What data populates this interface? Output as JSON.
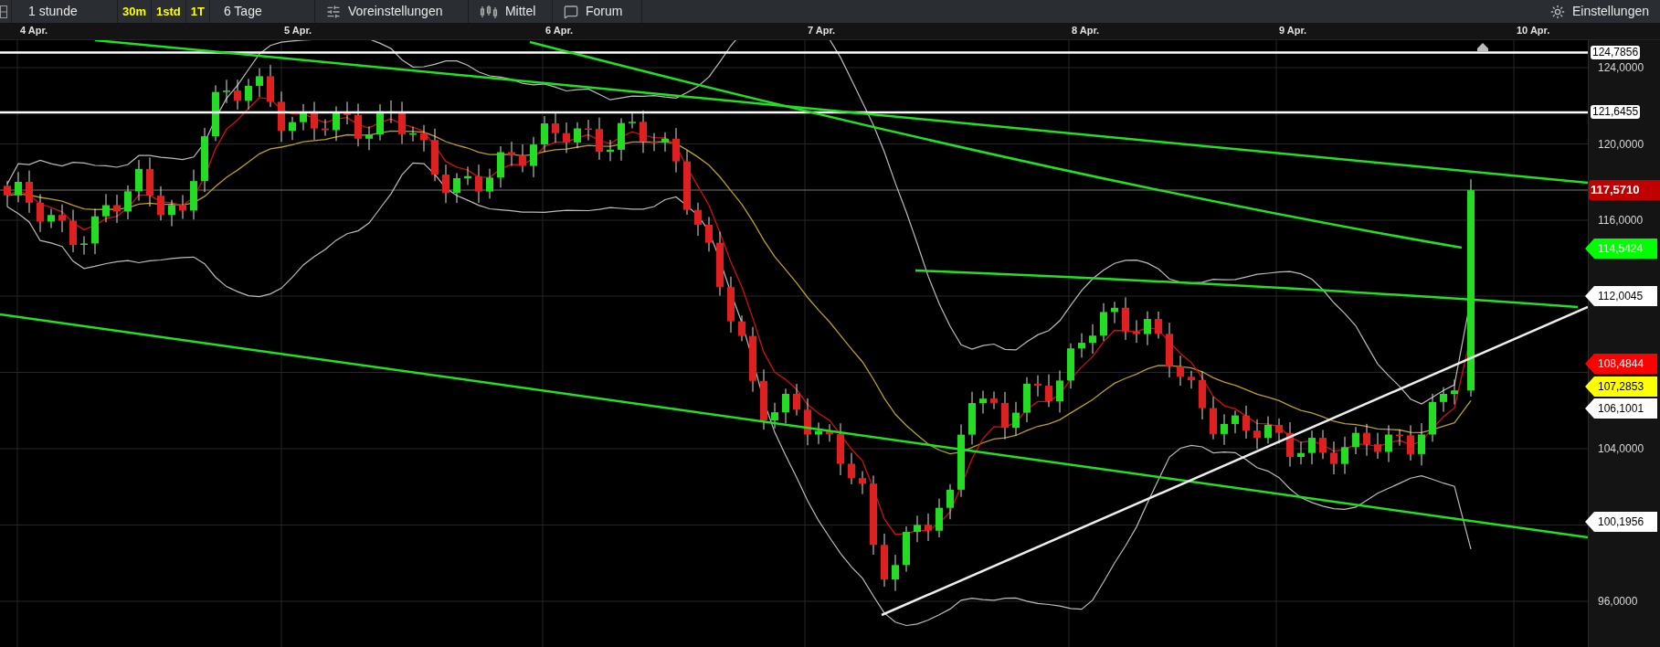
{
  "toolbar": {
    "items": [
      {
        "kind": "menu",
        "label": "1 stunde"
      },
      {
        "kind": "quick",
        "label": "30m"
      },
      {
        "kind": "quick",
        "label": "1std"
      },
      {
        "kind": "quick",
        "label": "1T"
      },
      {
        "kind": "menu",
        "label": "6 Tage"
      },
      {
        "kind": "presets",
        "label": "Voreinstellungen"
      },
      {
        "kind": "indicators",
        "label": "Mittel"
      },
      {
        "kind": "forum",
        "label": "Forum"
      }
    ],
    "settings": "Einstellungen"
  },
  "date_axis": [
    "4 Apr.",
    "5 Apr.",
    "6 Apr.",
    "7 Apr.",
    "8 Apr.",
    "9 Apr.",
    "10 Apr."
  ],
  "price_axis": [
    {
      "kind": "level",
      "label": "124,7856"
    },
    {
      "kind": "tick",
      "label": "124,0000"
    },
    {
      "kind": "level",
      "label": "121,6455"
    },
    {
      "kind": "tick",
      "label": "120,0000"
    },
    {
      "kind": "last",
      "label": "117,5710",
      "color": "#c00000"
    },
    {
      "kind": "tick",
      "label": "116,0000"
    },
    {
      "kind": "pointer",
      "label": "114,5424",
      "color": "#00ff00"
    },
    {
      "kind": "pointer",
      "label": "112,0045",
      "color": "#ffffff"
    },
    {
      "kind": "pointer",
      "label": "108,4844",
      "color": "#ff0000"
    },
    {
      "kind": "pointer",
      "label": "107,2853",
      "color": "#ffff00"
    },
    {
      "kind": "pointer",
      "label": "106,1001",
      "color": "#ffffff"
    },
    {
      "kind": "tick",
      "label": "104,0000"
    },
    {
      "kind": "pointer",
      "label": "100,1956",
      "color": "#ffffff"
    },
    {
      "kind": "tick",
      "label": "96,0000"
    }
  ]
}
